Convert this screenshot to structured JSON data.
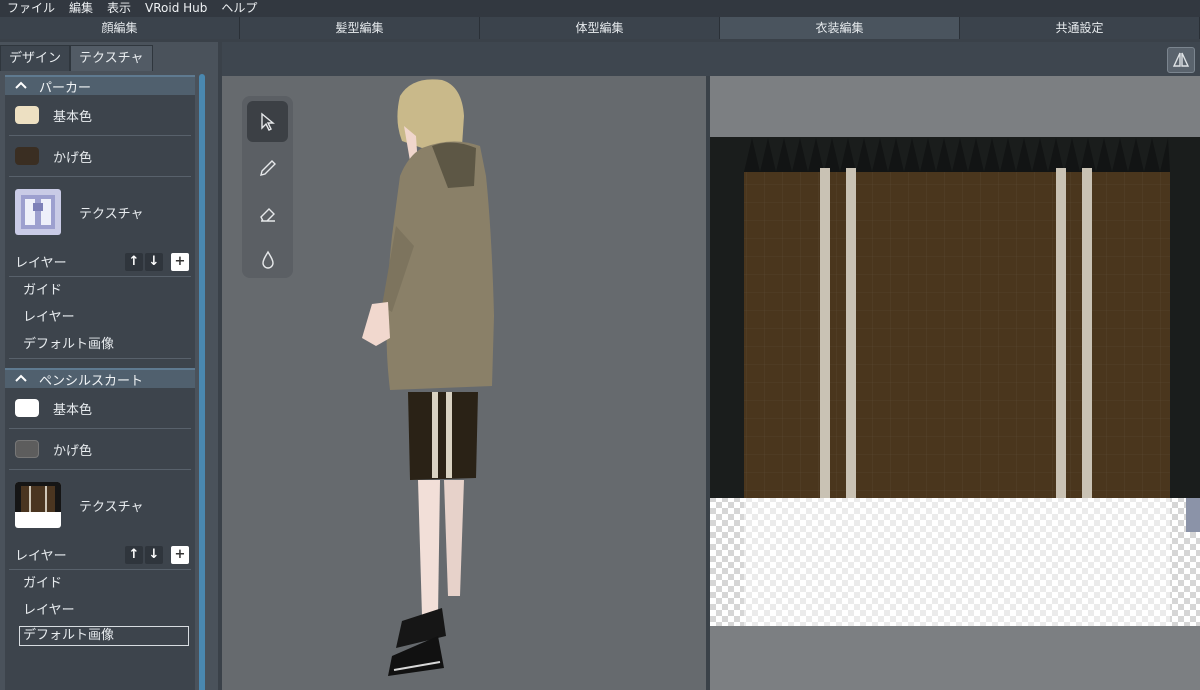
{
  "menu": {
    "file": "ファイル",
    "edit": "編集",
    "view": "表示",
    "hub": "VRoid Hub",
    "help": "ヘルプ"
  },
  "modes": [
    "顔編集",
    "髪型編集",
    "体型編集",
    "衣装編集",
    "共通設定"
  ],
  "subtabs": {
    "design": "デザイン",
    "texture": "テクスチャ"
  },
  "sections": [
    {
      "title": "パーカー",
      "base_color_label": "基本色",
      "base_color": "#ede0c2",
      "shade_color_label": "かげ色",
      "shade_color": "#3a2e22",
      "texture_label": "テクスチャ",
      "layer_label": "レイヤー",
      "items": [
        "ガイド",
        "レイヤー",
        "デフォルト画像"
      ]
    },
    {
      "title": "ペンシルスカート",
      "base_color_label": "基本色",
      "base_color": "#ffffff",
      "shade_color_label": "かげ色",
      "shade_color": "#5d5d5d",
      "texture_label": "テクスチャ",
      "layer_label": "レイヤー",
      "items": [
        "ガイド",
        "レイヤー",
        "デフォルト画像"
      ]
    }
  ],
  "icons": {
    "collapse": "chevron-up-icon",
    "up": "arrow-up-icon",
    "down": "arrow-down-icon",
    "add": "plus-icon",
    "mirror": "mirror-icon",
    "select": "cursor-icon",
    "pen": "pen-icon",
    "eraser": "eraser-icon",
    "fill": "drop-icon"
  },
  "colors": {
    "accent": "#4a88b0",
    "section_header": "#50606e"
  }
}
